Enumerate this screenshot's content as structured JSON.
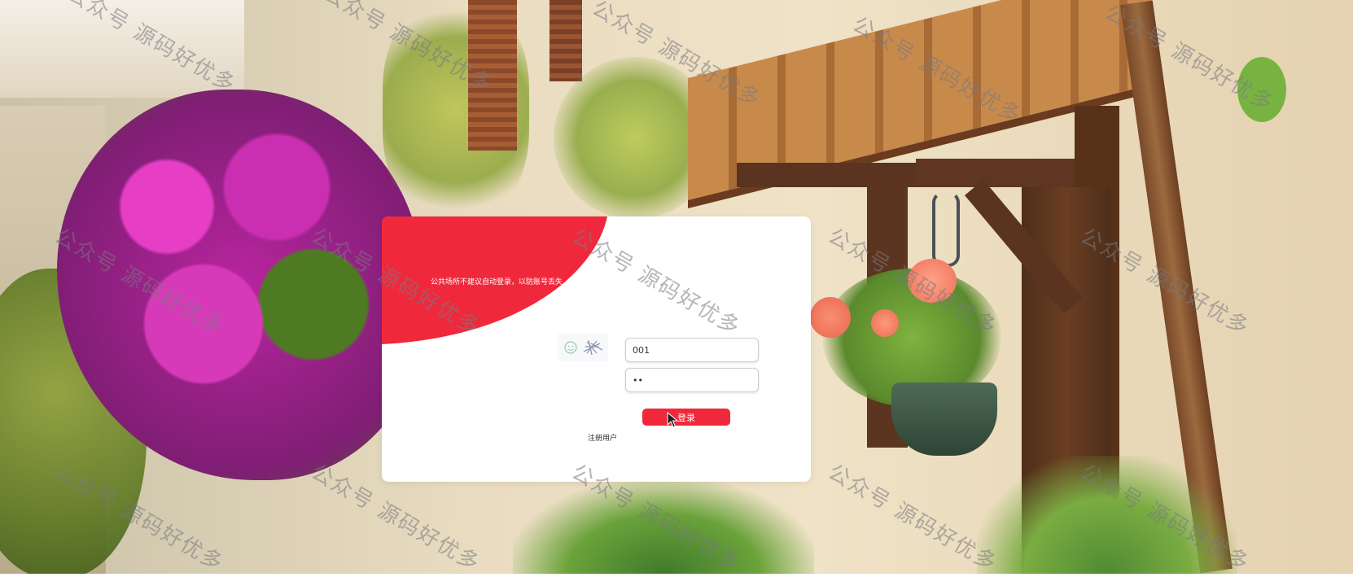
{
  "watermark": {
    "text": "公众号 源码好优多",
    "color": "#787882"
  },
  "login_card": {
    "notice": "公共场所不建议自动登录，以防账号丢失",
    "accent_color": "#f0283c",
    "captcha_icon": "captcha-image-icon",
    "username": {
      "value": "001"
    },
    "password": {
      "value": "••"
    },
    "login_label": "登录",
    "register_label": "注册用户"
  }
}
